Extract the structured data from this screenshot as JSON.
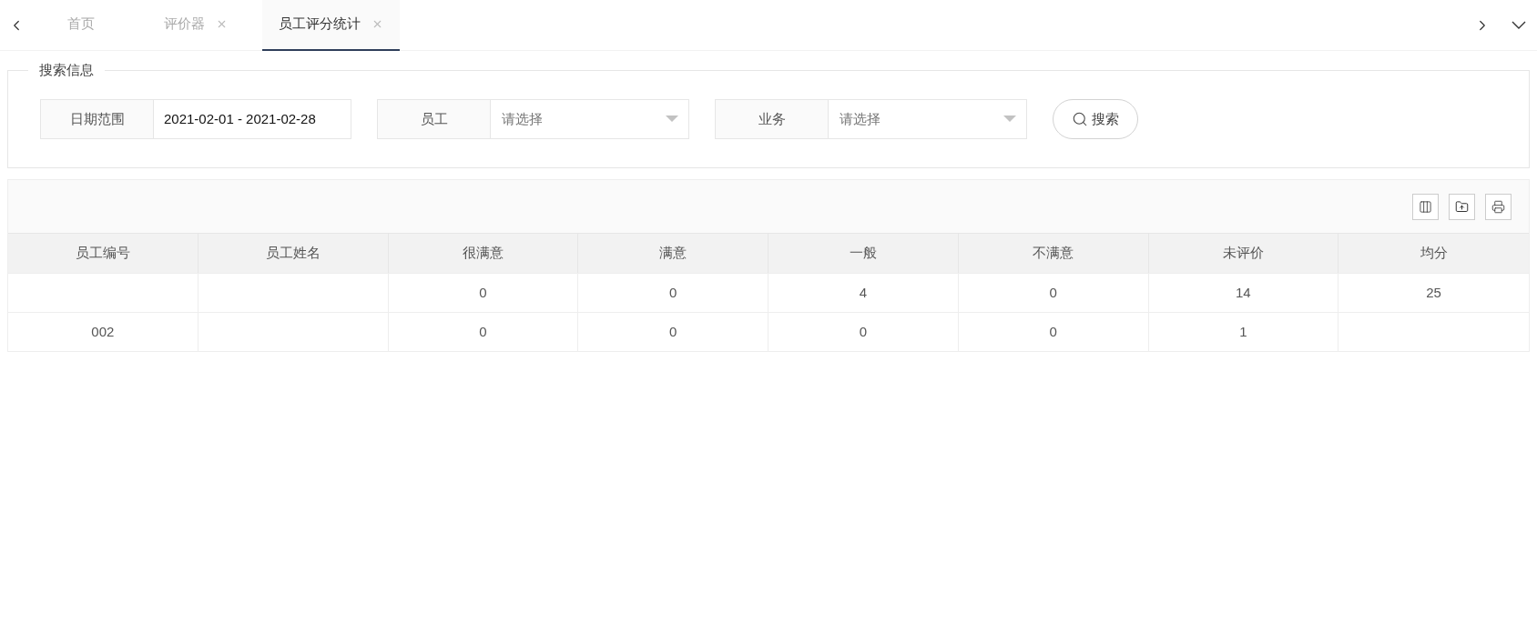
{
  "tabs": [
    {
      "label": "首页",
      "closable": false,
      "selected": false
    },
    {
      "label": "评价器",
      "closable": true,
      "selected": false
    },
    {
      "label": "员工评分统计",
      "closable": true,
      "selected": true
    }
  ],
  "search": {
    "legend": "搜索信息",
    "filters": [
      {
        "kind": "text",
        "label": "日期范围",
        "value": "2021-02-01 - 2021-02-28"
      },
      {
        "kind": "select",
        "label": "员工",
        "placeholder": "请选择"
      },
      {
        "kind": "select",
        "label": "业务",
        "placeholder": "请选择"
      }
    ],
    "button": "搜索"
  },
  "table": {
    "columns": [
      "员工编号",
      "员工姓名",
      "很满意",
      "满意",
      "一般",
      "不满意",
      "未评价",
      "均分"
    ],
    "rows": [
      [
        null,
        null,
        "0",
        "0",
        "4",
        "0",
        "14",
        "25"
      ],
      [
        "002",
        null,
        "0",
        "0",
        "0",
        "0",
        "1",
        null
      ]
    ]
  }
}
